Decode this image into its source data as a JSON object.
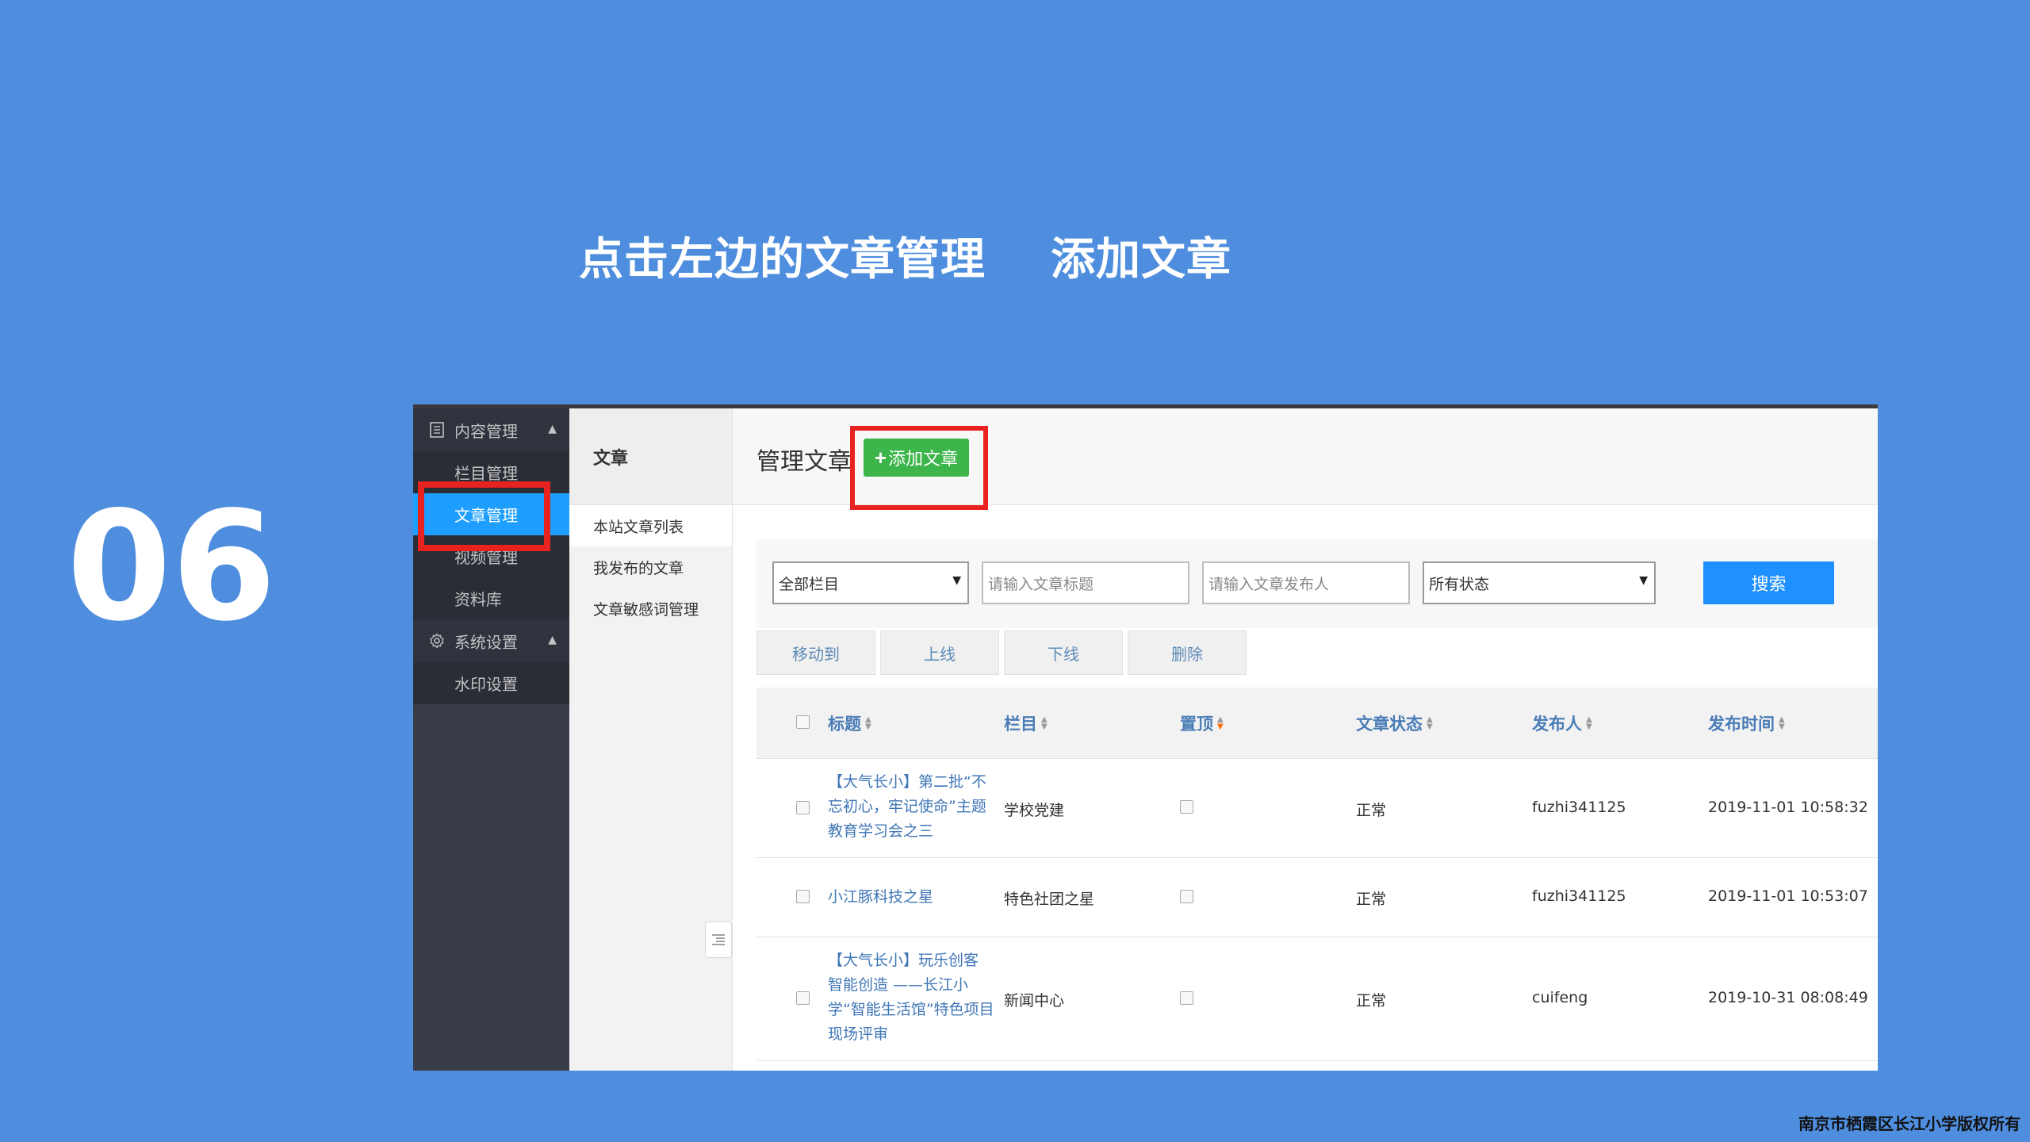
{
  "slide": {
    "title": "点击左边的文章管理    添加文章",
    "number": "06",
    "copyright": "南京市栖霞区长江小学版权所有"
  },
  "sidebar": {
    "groups": [
      {
        "label": "内容管理",
        "icon": "document-icon",
        "items": [
          "栏目管理",
          "文章管理",
          "视频管理",
          "资料库"
        ]
      },
      {
        "label": "系统设置",
        "icon": "gear-icon",
        "items": [
          "水印设置"
        ]
      }
    ],
    "active_item": "文章管理"
  },
  "subnav": {
    "header": "文章",
    "items": [
      "本站文章列表",
      "我发布的文章",
      "文章敏感词管理"
    ]
  },
  "main": {
    "title": "管理文章",
    "add_button": "添加文章"
  },
  "filters": {
    "category_select": "全部栏目",
    "title_placeholder": "请输入文章标题",
    "author_placeholder": "请输入文章发布人",
    "status_select": "所有状态",
    "search_button": "搜索"
  },
  "actions": [
    "移动到",
    "上线",
    "下线",
    "删除"
  ],
  "table": {
    "columns": [
      "标题",
      "栏目",
      "置顶",
      "文章状态",
      "发布人",
      "发布时间"
    ],
    "rows": [
      {
        "title": "【大气长小】第二批“不忘初心，牢记使命”主题教育学习会之三",
        "category": "学校党建",
        "status": "正常",
        "author": "fuzhi341125",
        "time": "2019-11-01 10:58:32"
      },
      {
        "title": "小江豚科技之星",
        "category": "特色社团之星",
        "status": "正常",
        "author": "fuzhi341125",
        "time": "2019-11-01 10:53:07"
      },
      {
        "title": "【大气长小】玩乐创客 智能创造 ——长江小学“智能生活馆”特色项目现场评审",
        "category": "新闻中心",
        "status": "正常",
        "author": "cuifeng",
        "time": "2019-10-31 08:08:49"
      }
    ]
  },
  "colors": {
    "slide_background": "#4f8ede",
    "sidebar": "#393d49",
    "active_blue": "#1e9fff",
    "add_green": "#3cb54a",
    "highlight_red": "#e8231f"
  }
}
